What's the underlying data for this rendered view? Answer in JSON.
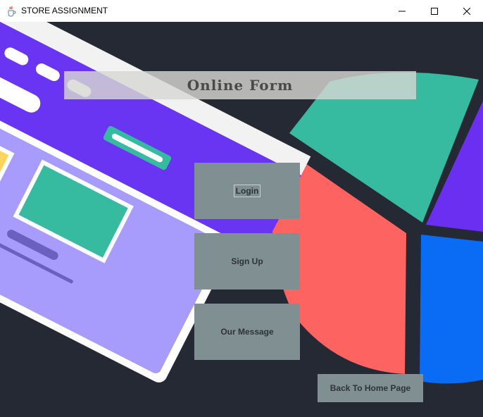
{
  "window": {
    "title": "STORE ASSIGNMENT",
    "icons": {
      "app": "java-cup-icon",
      "minimize": "minimize-icon",
      "maximize": "maximize-icon",
      "close": "close-icon"
    }
  },
  "header": {
    "title": "Online Form"
  },
  "menu": {
    "login_label": "Login",
    "signup_label": "Sign Up",
    "message_label": "Our Message"
  },
  "footer": {
    "home_label": "Back To Home Page"
  },
  "colors": {
    "background": "#252933",
    "button": "#7f8f92",
    "button_text": "#2e3436",
    "banner": "#d7d7d2",
    "pie_green": "#36bba0",
    "pie_red": "#fd6461",
    "pie_purple": "#6a2ff0",
    "pie_blue": "#0a6cf5",
    "card_purple": "#a79bfb",
    "card_yellow": "#fbd55e"
  }
}
